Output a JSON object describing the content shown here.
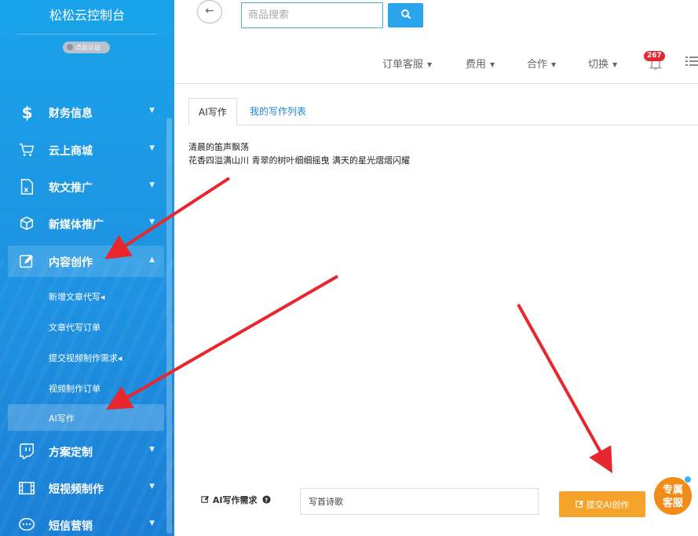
{
  "sidebar": {
    "brand": "松松云控制台",
    "verify_label": "点此认证",
    "menu": [
      {
        "label": "财务信息",
        "icon": "dollar-icon"
      },
      {
        "label": "云上商城",
        "icon": "cart-icon"
      },
      {
        "label": "软文推广",
        "icon": "excel-doc-icon"
      },
      {
        "label": "新媒体推广",
        "icon": "cube-icon"
      },
      {
        "label": "内容创作",
        "icon": "edit-icon"
      },
      {
        "label": "方案定制",
        "icon": "twitch-icon"
      },
      {
        "label": "短视频制作",
        "icon": "film-icon"
      },
      {
        "label": "短信营销",
        "icon": "chat-icon"
      }
    ],
    "submenu": [
      {
        "label": "新增文章代写◂"
      },
      {
        "label": "文章代写订单"
      },
      {
        "label": "提交视频制作需求◂"
      },
      {
        "label": "视频制作订单"
      },
      {
        "label": "AI写作"
      }
    ]
  },
  "header": {
    "search_placeholder": "商品搜索",
    "nav": [
      "订单客服",
      "费用",
      "合作",
      "切换"
    ],
    "notification_count": "267"
  },
  "tabs": [
    "AI写作",
    "我的写作列表"
  ],
  "poem": {
    "line1": "清晨的笛声飘荡",
    "line2": "花香四溢满山川 青翠的树叶细细摇曳 满天的星光熠熠闪耀"
  },
  "form": {
    "label": "AI写作需求",
    "value": "写首诗歌",
    "submit_label": "提交AI创作"
  },
  "service": {
    "line1": "专属",
    "line2": "客服"
  },
  "colors": {
    "sidebar": "#1aa3ea",
    "accent": "#2aa5eb",
    "submit": "#f5a32a",
    "badge": "#e8262d",
    "arrow": "#e8262d"
  }
}
